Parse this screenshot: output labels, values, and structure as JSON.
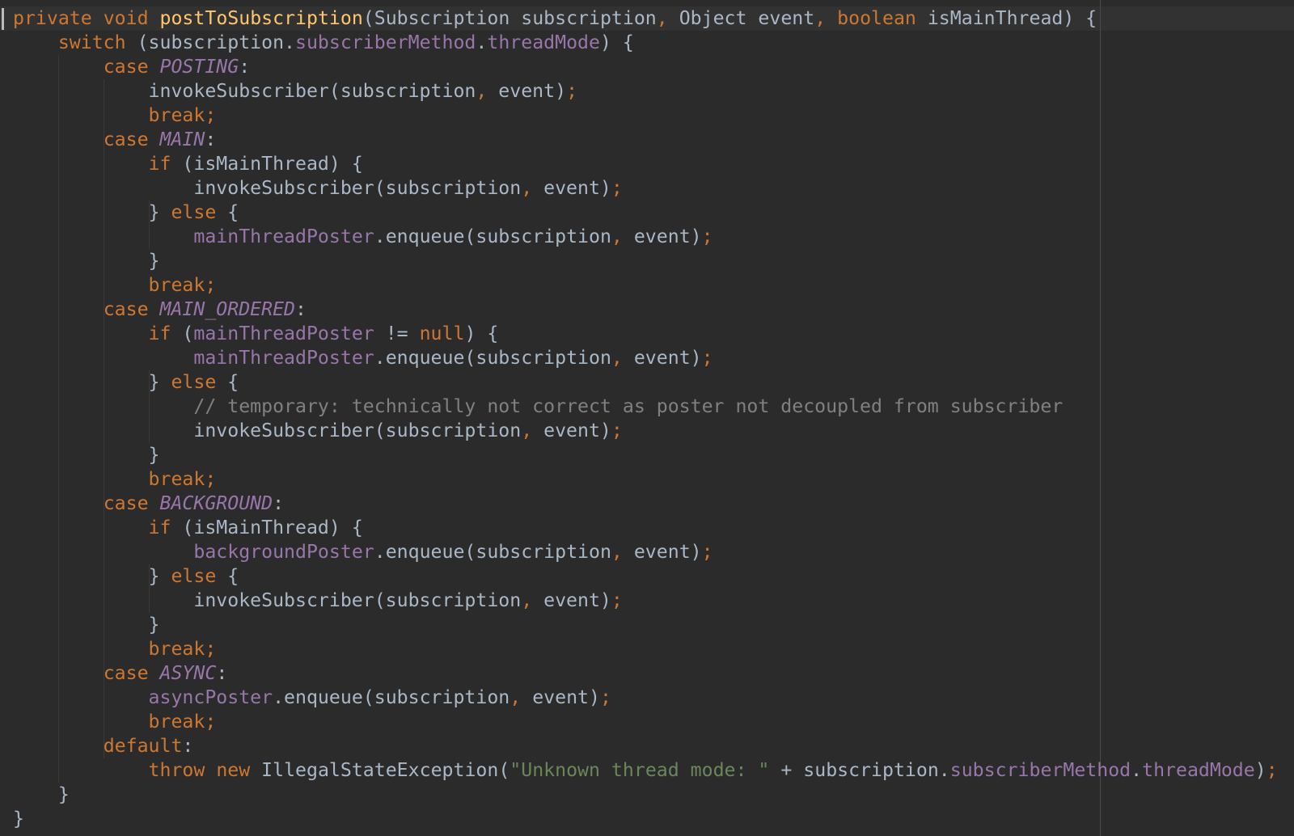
{
  "editor": {
    "theme": {
      "background": "#2b2b2b",
      "current_line": "#323232",
      "keyword": "#cc7832",
      "function_decl": "#ffc66d",
      "field": "#9876aa",
      "string": "#6a8759",
      "comment": "#808080",
      "text": "#a9b7c6"
    },
    "lines": [
      [
        [
          "kw",
          "private"
        ],
        [
          "plain",
          " "
        ],
        [
          "kw",
          "void"
        ],
        [
          "plain",
          " "
        ],
        [
          "fn",
          "postToSubscription"
        ],
        [
          "plain",
          "(Subscription subscription"
        ],
        [
          "punct",
          ","
        ],
        [
          "plain",
          " Object event"
        ],
        [
          "punct",
          ","
        ],
        [
          "plain",
          " "
        ],
        [
          "kw",
          "boolean"
        ],
        [
          "plain",
          " isMainThread) {"
        ]
      ],
      [
        [
          "plain",
          "    "
        ],
        [
          "kw",
          "switch"
        ],
        [
          "plain",
          " (subscription."
        ],
        [
          "field",
          "subscriberMethod"
        ],
        [
          "plain",
          "."
        ],
        [
          "field",
          "threadMode"
        ],
        [
          "plain",
          ") {"
        ]
      ],
      [
        [
          "plain",
          "        "
        ],
        [
          "kw",
          "case"
        ],
        [
          "plain",
          " "
        ],
        [
          "const",
          "POSTING"
        ],
        [
          "plain",
          ":"
        ]
      ],
      [
        [
          "plain",
          "            invokeSubscriber(subscription"
        ],
        [
          "punct",
          ","
        ],
        [
          "plain",
          " event)"
        ],
        [
          "punct",
          ";"
        ]
      ],
      [
        [
          "plain",
          "            "
        ],
        [
          "kw",
          "break;"
        ]
      ],
      [
        [
          "plain",
          "        "
        ],
        [
          "kw",
          "case"
        ],
        [
          "plain",
          " "
        ],
        [
          "const",
          "MAIN"
        ],
        [
          "plain",
          ":"
        ]
      ],
      [
        [
          "plain",
          "            "
        ],
        [
          "kw",
          "if"
        ],
        [
          "plain",
          " (isMainThread) {"
        ]
      ],
      [
        [
          "plain",
          "                invokeSubscriber(subscription"
        ],
        [
          "punct",
          ","
        ],
        [
          "plain",
          " event)"
        ],
        [
          "punct",
          ";"
        ]
      ],
      [
        [
          "plain",
          "            } "
        ],
        [
          "kw",
          "else"
        ],
        [
          "plain",
          " {"
        ]
      ],
      [
        [
          "plain",
          "                "
        ],
        [
          "field",
          "mainThreadPoster"
        ],
        [
          "plain",
          ".enqueue(subscription"
        ],
        [
          "punct",
          ","
        ],
        [
          "plain",
          " event)"
        ],
        [
          "punct",
          ";"
        ]
      ],
      [
        [
          "plain",
          "            }"
        ]
      ],
      [
        [
          "plain",
          "            "
        ],
        [
          "kw",
          "break;"
        ]
      ],
      [
        [
          "plain",
          "        "
        ],
        [
          "kw",
          "case"
        ],
        [
          "plain",
          " "
        ],
        [
          "const",
          "MAIN_ORDERED"
        ],
        [
          "plain",
          ":"
        ]
      ],
      [
        [
          "plain",
          "            "
        ],
        [
          "kw",
          "if"
        ],
        [
          "plain",
          " ("
        ],
        [
          "field",
          "mainThreadPoster"
        ],
        [
          "plain",
          " != "
        ],
        [
          "kw",
          "null"
        ],
        [
          "plain",
          ") {"
        ]
      ],
      [
        [
          "plain",
          "                "
        ],
        [
          "field",
          "mainThreadPoster"
        ],
        [
          "plain",
          ".enqueue(subscription"
        ],
        [
          "punct",
          ","
        ],
        [
          "plain",
          " event)"
        ],
        [
          "punct",
          ";"
        ]
      ],
      [
        [
          "plain",
          "            } "
        ],
        [
          "kw",
          "else"
        ],
        [
          "plain",
          " {"
        ]
      ],
      [
        [
          "plain",
          "                "
        ],
        [
          "cmt",
          "// temporary: technically not correct as poster not decoupled from subscriber"
        ]
      ],
      [
        [
          "plain",
          "                invokeSubscriber(subscription"
        ],
        [
          "punct",
          ","
        ],
        [
          "plain",
          " event)"
        ],
        [
          "punct",
          ";"
        ]
      ],
      [
        [
          "plain",
          "            }"
        ]
      ],
      [
        [
          "plain",
          "            "
        ],
        [
          "kw",
          "break;"
        ]
      ],
      [
        [
          "plain",
          "        "
        ],
        [
          "kw",
          "case"
        ],
        [
          "plain",
          " "
        ],
        [
          "const",
          "BACKGROUND"
        ],
        [
          "plain",
          ":"
        ]
      ],
      [
        [
          "plain",
          "            "
        ],
        [
          "kw",
          "if"
        ],
        [
          "plain",
          " (isMainThread) {"
        ]
      ],
      [
        [
          "plain",
          "                "
        ],
        [
          "field",
          "backgroundPoster"
        ],
        [
          "plain",
          ".enqueue(subscription"
        ],
        [
          "punct",
          ","
        ],
        [
          "plain",
          " event)"
        ],
        [
          "punct",
          ";"
        ]
      ],
      [
        [
          "plain",
          "            } "
        ],
        [
          "kw",
          "else"
        ],
        [
          "plain",
          " {"
        ]
      ],
      [
        [
          "plain",
          "                invokeSubscriber(subscription"
        ],
        [
          "punct",
          ","
        ],
        [
          "plain",
          " event)"
        ],
        [
          "punct",
          ";"
        ]
      ],
      [
        [
          "plain",
          "            }"
        ]
      ],
      [
        [
          "plain",
          "            "
        ],
        [
          "kw",
          "break;"
        ]
      ],
      [
        [
          "plain",
          "        "
        ],
        [
          "kw",
          "case"
        ],
        [
          "plain",
          " "
        ],
        [
          "const",
          "ASYNC"
        ],
        [
          "plain",
          ":"
        ]
      ],
      [
        [
          "plain",
          "            "
        ],
        [
          "field",
          "asyncPoster"
        ],
        [
          "plain",
          ".enqueue(subscription"
        ],
        [
          "punct",
          ","
        ],
        [
          "plain",
          " event)"
        ],
        [
          "punct",
          ";"
        ]
      ],
      [
        [
          "plain",
          "            "
        ],
        [
          "kw",
          "break;"
        ]
      ],
      [
        [
          "plain",
          "        "
        ],
        [
          "kw",
          "default"
        ],
        [
          "plain",
          ":"
        ]
      ],
      [
        [
          "plain",
          "            "
        ],
        [
          "kw",
          "throw"
        ],
        [
          "plain",
          " "
        ],
        [
          "kw",
          "new"
        ],
        [
          "plain",
          " IllegalStateException("
        ],
        [
          "str",
          "\"Unknown thread mode: \""
        ],
        [
          "plain",
          " + subscription."
        ],
        [
          "field",
          "subscriberMethod"
        ],
        [
          "plain",
          "."
        ],
        [
          "field",
          "threadMode"
        ],
        [
          "plain",
          ")"
        ],
        [
          "punct",
          ";"
        ]
      ],
      [
        [
          "plain",
          "    }"
        ]
      ],
      [
        [
          "plain",
          "}"
        ]
      ]
    ]
  }
}
